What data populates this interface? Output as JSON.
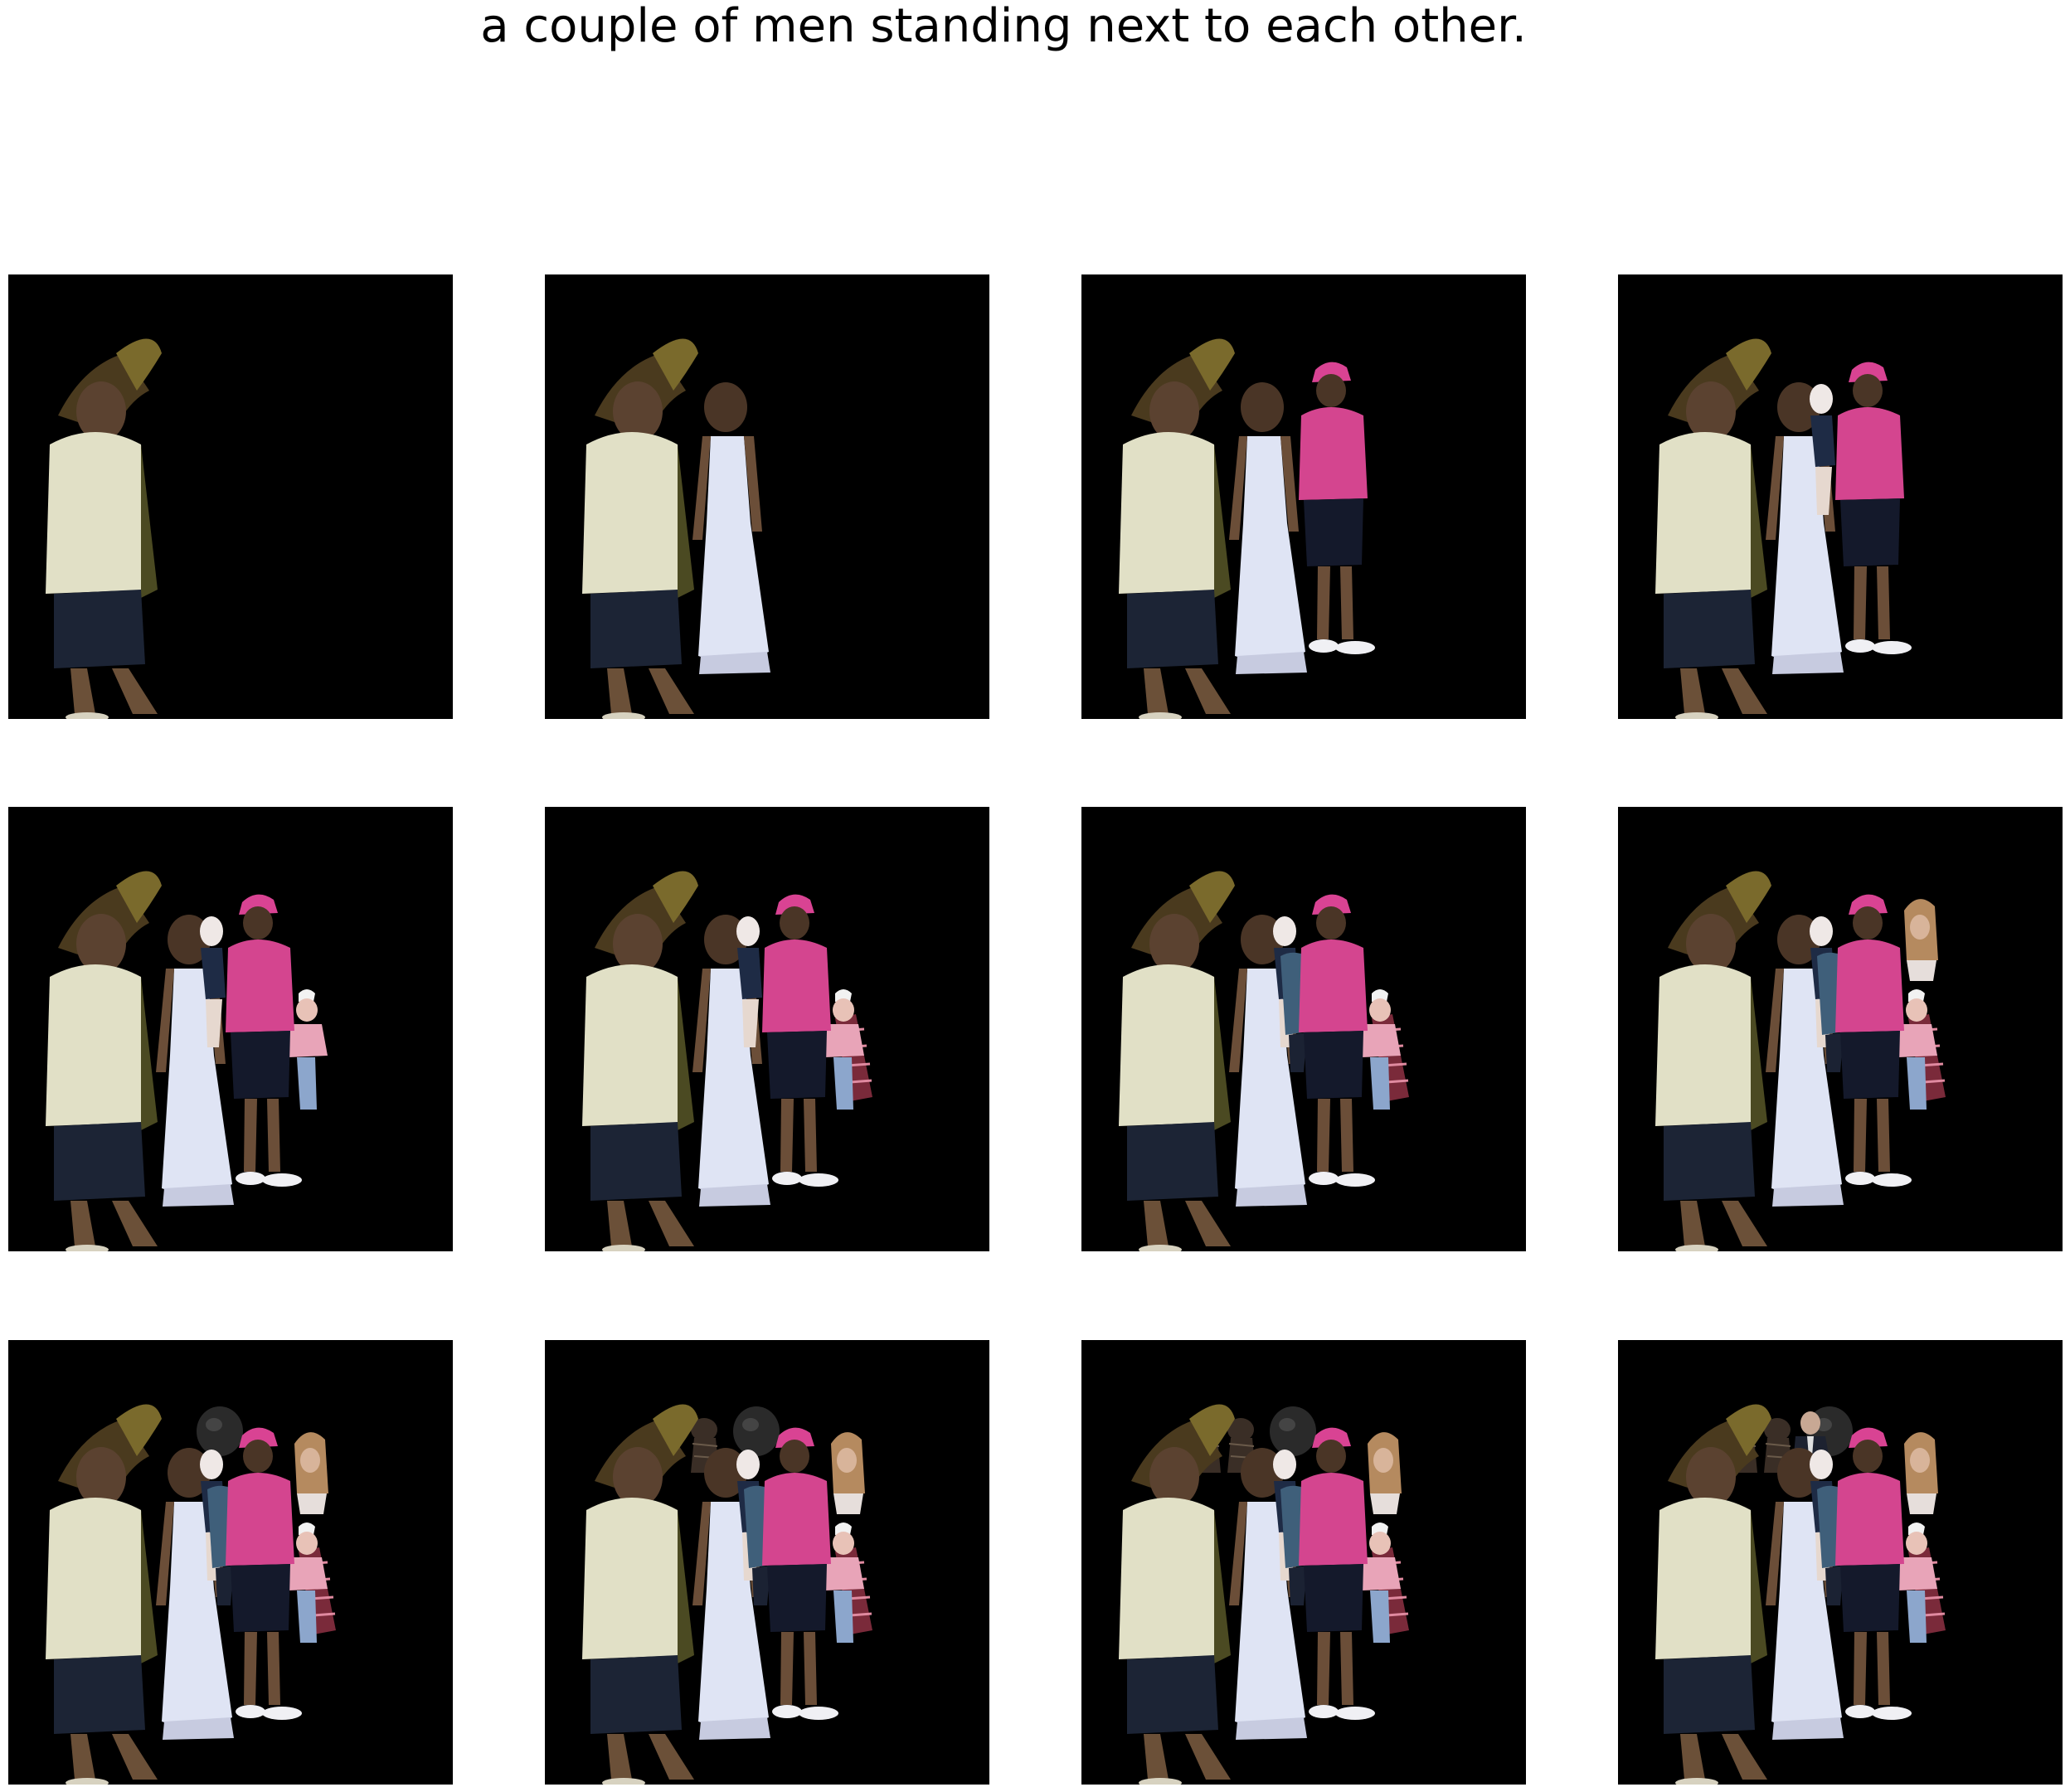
{
  "caption": "a couple of men standing next to each other.",
  "figure": {
    "layout": {
      "rows": 3,
      "columns": 4
    },
    "panel_background": "#000000",
    "panels": [
      {
        "step": 1,
        "figures": [
          "man-white-shirt"
        ]
      },
      {
        "step": 2,
        "figures": [
          "man-white-shirt",
          "woman-white-dress"
        ]
      },
      {
        "step": 3,
        "figures": [
          "man-white-shirt",
          "woman-white-dress",
          "person-pink-hoodie"
        ]
      },
      {
        "step": 4,
        "figures": [
          "man-white-shirt",
          "woman-white-dress",
          "person-pink-hoodie",
          "child-partial"
        ]
      },
      {
        "step": 5,
        "figures": [
          "man-white-shirt",
          "woman-white-dress",
          "person-pink-hoodie",
          "child-partial",
          "child-pink"
        ]
      },
      {
        "step": 6,
        "figures": [
          "man-white-shirt",
          "woman-white-dress",
          "person-pink-hoodie",
          "child-partial",
          "child-pink",
          "plaid-figure"
        ]
      },
      {
        "step": 7,
        "figures": [
          "man-white-shirt",
          "woman-white-dress",
          "person-pink-hoodie",
          "child-partial",
          "child-pink",
          "plaid-figure",
          "blue-jacket-figure"
        ]
      },
      {
        "step": 8,
        "figures": [
          "man-white-shirt",
          "woman-white-dress",
          "person-pink-hoodie",
          "child-partial",
          "child-pink",
          "plaid-figure",
          "blue-jacket-figure",
          "blonde-woman"
        ]
      },
      {
        "step": 9,
        "figures": [
          "man-white-shirt",
          "woman-white-dress",
          "person-pink-hoodie",
          "child-partial",
          "child-pink",
          "plaid-figure",
          "blue-jacket-figure",
          "blonde-woman",
          "dark-head"
        ]
      },
      {
        "step": 10,
        "figures": [
          "man-white-shirt",
          "woman-white-dress",
          "person-pink-hoodie",
          "child-partial",
          "child-pink",
          "plaid-figure",
          "blue-jacket-figure",
          "blonde-woman",
          "dark-head",
          "small-dark-figure"
        ]
      },
      {
        "step": 11,
        "figures": [
          "man-white-shirt",
          "woman-white-dress",
          "person-pink-hoodie",
          "child-partial",
          "child-pink",
          "plaid-figure",
          "blue-jacket-figure",
          "blonde-woman",
          "dark-head",
          "small-dark-figure",
          "small-dark-figure-2"
        ]
      },
      {
        "step": 12,
        "figures": [
          "man-white-shirt",
          "woman-white-dress",
          "person-pink-hoodie",
          "child-partial",
          "child-pink",
          "plaid-figure",
          "blue-jacket-figure",
          "blonde-woman",
          "dark-head",
          "small-dark-figure",
          "small-dark-figure-2",
          "man-in-suit"
        ]
      }
    ]
  }
}
